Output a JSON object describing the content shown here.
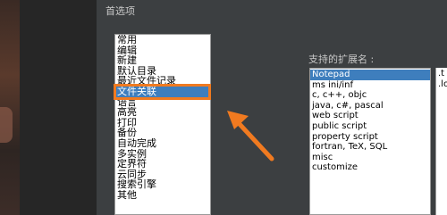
{
  "window": {
    "title": "首选项"
  },
  "categories": [
    {
      "label": "常用"
    },
    {
      "label": "编辑"
    },
    {
      "label": "新建"
    },
    {
      "label": "默认目录"
    },
    {
      "label": "最近文件记录"
    },
    {
      "label": "文件关联",
      "selected": true
    },
    {
      "label": "语言"
    },
    {
      "label": "高亮"
    },
    {
      "label": "打印"
    },
    {
      "label": "备份"
    },
    {
      "label": "自动完成"
    },
    {
      "label": "多实例"
    },
    {
      "label": "定界符"
    },
    {
      "label": "云同步"
    },
    {
      "label": "搜索引擎"
    },
    {
      "label": "其他"
    }
  ],
  "extensions": {
    "label": "支持的扩展名 :",
    "items": [
      {
        "label": "Notepad",
        "selected": true
      },
      {
        "label": "ms ini/inf"
      },
      {
        "label": "c, c++, objc"
      },
      {
        "label": "java, c#, pascal"
      },
      {
        "label": "web script"
      },
      {
        "label": "public script"
      },
      {
        "label": "property script"
      },
      {
        "label": "fortran, TeX, SQL"
      },
      {
        "label": "misc"
      },
      {
        "label": "customize"
      }
    ],
    "registered": [
      ".t",
      ".lo"
    ]
  },
  "colors": {
    "selection": "#3e7ebd",
    "annotation": "#f07a20",
    "dialog_bg": "#3c3f41"
  }
}
